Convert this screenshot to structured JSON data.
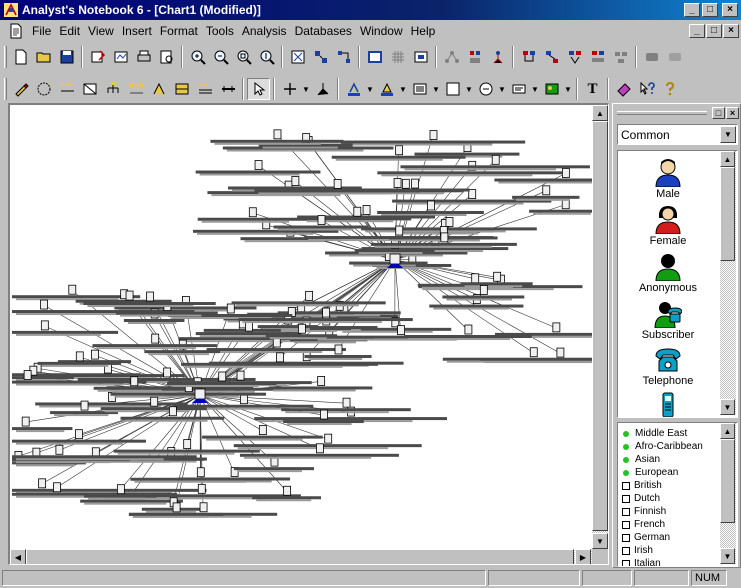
{
  "window": {
    "title": "Analyst's Notebook 6 - [Chart1 (Modified)]",
    "minimize": "_",
    "maximize": "□",
    "close": "×"
  },
  "menu": {
    "items": [
      {
        "label": "File"
      },
      {
        "label": "Edit"
      },
      {
        "label": "View"
      },
      {
        "label": "Insert"
      },
      {
        "label": "Format"
      },
      {
        "label": "Tools"
      },
      {
        "label": "Analysis"
      },
      {
        "label": "Databases"
      },
      {
        "label": "Window"
      },
      {
        "label": "Help"
      }
    ]
  },
  "toolbar_formatting": {
    "text_tool": "T"
  },
  "palette": {
    "category": "Common",
    "icons": [
      {
        "label": "Male",
        "icon": "male-person-icon",
        "color": "#1a3fbf"
      },
      {
        "label": "Female",
        "icon": "female-person-icon",
        "color": "#d41c1c"
      },
      {
        "label": "Anonymous",
        "icon": "anonymous-person-icon",
        "color": "#119c11"
      },
      {
        "label": "Subscriber",
        "icon": "subscriber-icon",
        "color": "#0b9c9c"
      },
      {
        "label": "Telephone",
        "icon": "telephone-icon",
        "color": "#0aa0c8"
      }
    ],
    "attributes": [
      {
        "label": "Middle East",
        "kind": "dot"
      },
      {
        "label": "Afro-Caribbean",
        "kind": "dot"
      },
      {
        "label": "Asian",
        "kind": "dot"
      },
      {
        "label": "European",
        "kind": "dot"
      },
      {
        "label": "British",
        "kind": "checkbox"
      },
      {
        "label": "Dutch",
        "kind": "checkbox"
      },
      {
        "label": "Finnish",
        "kind": "checkbox"
      },
      {
        "label": "French",
        "kind": "checkbox"
      },
      {
        "label": "German",
        "kind": "checkbox"
      },
      {
        "label": "Irish",
        "kind": "checkbox"
      },
      {
        "label": "Italian",
        "kind": "checkbox"
      }
    ]
  },
  "status": {
    "num": "NUM"
  },
  "colors": {
    "titlebar": "#00007b",
    "entity_link": "#000000",
    "hub": "#0000c0"
  }
}
